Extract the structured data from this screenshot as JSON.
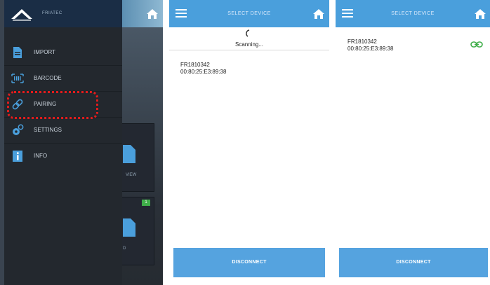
{
  "panel1": {
    "brand": "FRIATEC",
    "menu": [
      {
        "label": "IMPORT",
        "icon": "import-icon"
      },
      {
        "label": "BARCODE",
        "icon": "barcode-icon"
      },
      {
        "label": "PAIRING",
        "icon": "link-icon"
      },
      {
        "label": "SETTINGS",
        "icon": "gears-icon"
      },
      {
        "label": "INFO",
        "icon": "info-icon"
      }
    ],
    "background_tile_label": "VIEW",
    "background_tile_label2": "D",
    "badge": "1",
    "highlight_color": "#e21c1c"
  },
  "panel2": {
    "title": "SELECT DEVICE",
    "scanning_text": "Scanning...",
    "device": {
      "name": "FR1810342",
      "mac": "00:80:25:E3:89:38"
    },
    "disconnect_label": "DISCONNECT"
  },
  "panel3": {
    "title": "SELECT DEVICE",
    "device": {
      "name": "FR1810342",
      "mac": "00:80:25:E3:89:38"
    },
    "disconnect_label": "DISCONNECT",
    "connected_icon_color": "#3fae49"
  },
  "colors": {
    "accent": "#4a9fdc",
    "drawer": "#23282e"
  }
}
